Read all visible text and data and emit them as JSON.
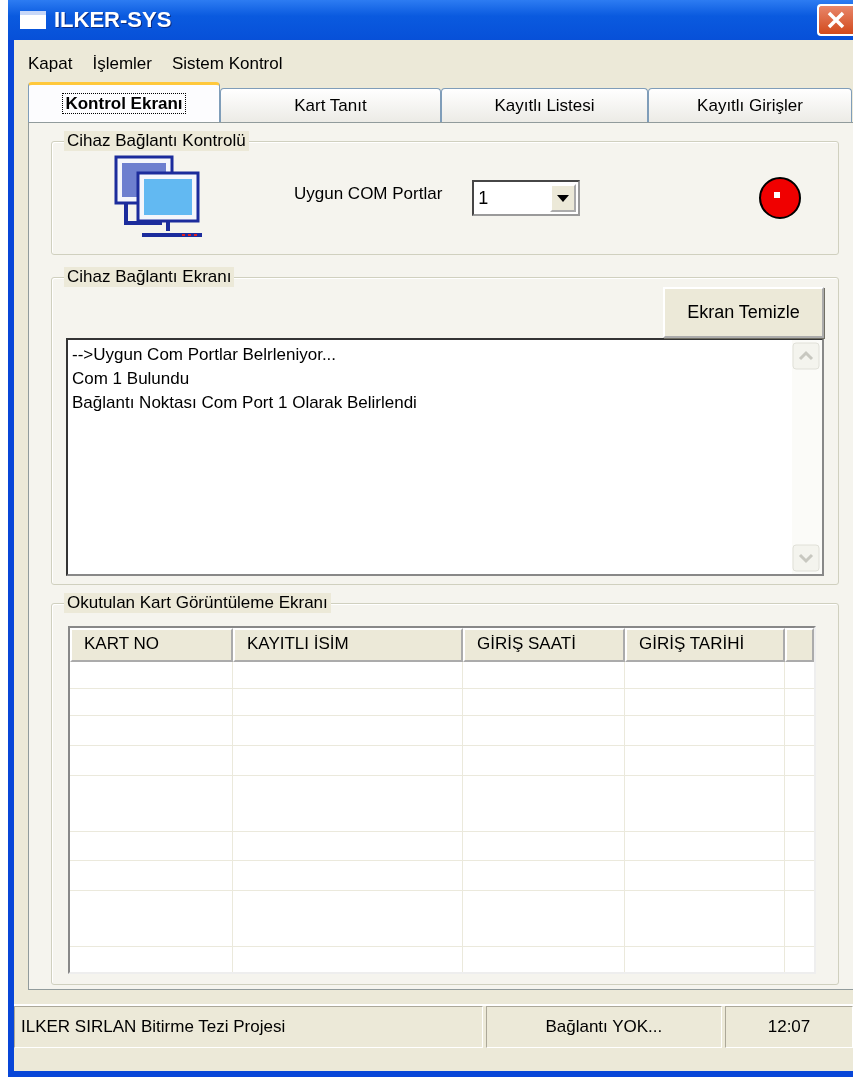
{
  "window": {
    "title": "ILKER-SYS"
  },
  "menu": [
    "Kapat",
    "İşlemler",
    "Sistem Kontrol"
  ],
  "tabs": [
    {
      "label": "Kontrol Ekranı",
      "selected": true
    },
    {
      "label": "Kart Tanıt",
      "selected": false
    },
    {
      "label": "Kayıtlı Listesi",
      "selected": false
    },
    {
      "label": "Kayıtlı Girişler",
      "selected": false
    }
  ],
  "connection_group": {
    "title": "Cihaz Bağlantı Kontrolü",
    "port_label": "Uygun COM Portlar",
    "port_value": "1",
    "connected": false
  },
  "log_group": {
    "title": "Cihaz Bağlantı Ekranı",
    "clear_button": "Ekran Temizle",
    "lines": [
      "-->Uygun Com Portlar Belrleniyor...",
      "Com 1 Bulundu",
      "Bağlantı Noktası Com Port 1 Olarak Belirlendi"
    ]
  },
  "cards_group": {
    "title": "Okutulan Kart Görüntüleme Ekranı",
    "columns": [
      "KART NO",
      "KAYITLI İSİM",
      "GİRİŞ SAATİ",
      "GİRİŞ TARİHİ"
    ]
  },
  "status_bar": [
    "ILKER SIRLAN Bitirme Tezi Projesi",
    "Bağlantı YOK...",
    "12:07"
  ]
}
